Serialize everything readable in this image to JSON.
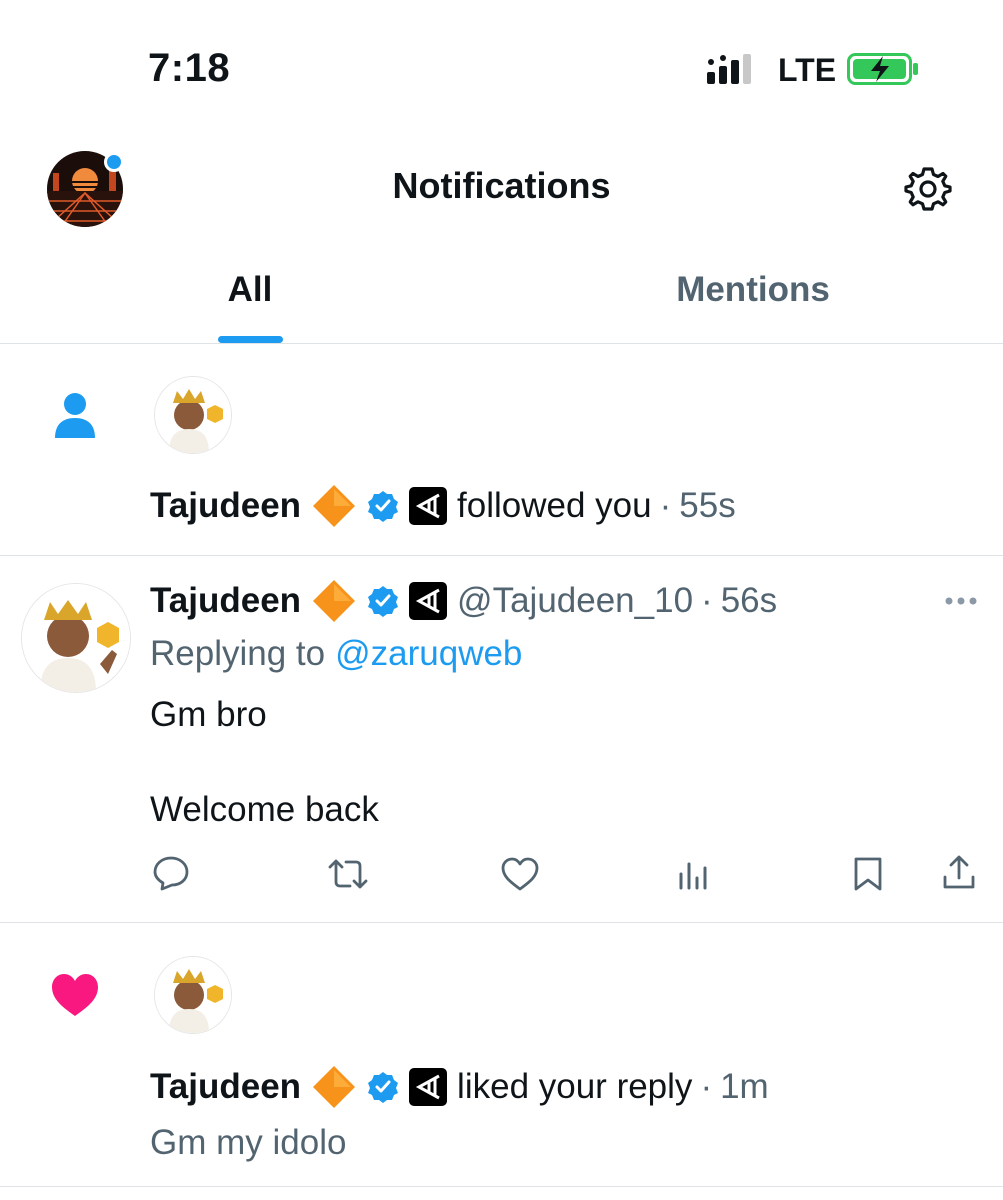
{
  "status_bar": {
    "time": "7:18",
    "network": "LTE"
  },
  "header": {
    "title": "Notifications"
  },
  "tabs": [
    {
      "label": "All",
      "active": true
    },
    {
      "label": "Mentions",
      "active": false
    }
  ],
  "notifications": [
    {
      "type": "follow",
      "icon": "person-icon",
      "name": "Tajudeen",
      "action": "followed you",
      "time": "55s"
    },
    {
      "type": "reply",
      "name": "Tajudeen",
      "handle": "@Tajudeen_10",
      "time": "56s",
      "replying_prefix": "Replying to",
      "replying_to": "@zaruqweb",
      "text_line1": "Gm bro",
      "text_line2": "Welcome back"
    },
    {
      "type": "like",
      "icon": "heart-icon",
      "name": "Tajudeen",
      "action": "liked your reply",
      "time": "1m",
      "quoted": "Gm my idolo"
    }
  ],
  "colors": {
    "accent": "#1d9bf0",
    "like": "#f91880",
    "badge_orange": "#f7931a"
  }
}
